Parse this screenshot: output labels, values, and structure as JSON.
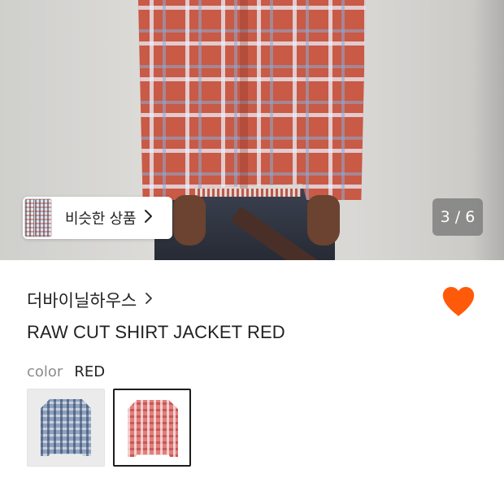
{
  "gallery": {
    "similar_label": "비슷한 상품",
    "current_page": 3,
    "total_pages": 6,
    "counter_text": "3 / 6"
  },
  "product": {
    "brand": "더바이닐하우스",
    "title": "RAW CUT SHIRT JACKET RED",
    "wishlisted": true,
    "color_key": "color",
    "color_value": "RED",
    "options": [
      {
        "color": "BLUE",
        "selected": false
      },
      {
        "color": "RED",
        "selected": true
      }
    ]
  },
  "icons": {
    "brand_link": "chevron-right-icon",
    "similar_link": "chevron-right-icon",
    "wishlist": "heart-icon"
  },
  "colors": {
    "accent": "#ff5a0a",
    "counter_bg": "#787878",
    "selected_border": "#1c1c1c"
  }
}
